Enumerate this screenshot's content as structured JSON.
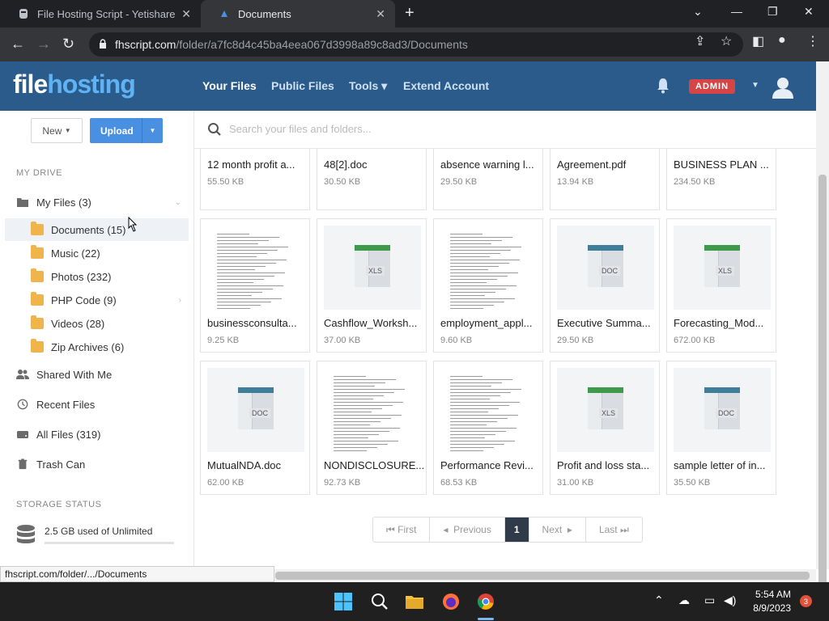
{
  "browser": {
    "tabs": [
      {
        "title": "File Hosting Script - Yetishare",
        "active": false
      },
      {
        "title": "Documents",
        "active": true
      }
    ],
    "url_host": "fhscript.com",
    "url_path": "/folder/a7fc8d4c45ba4eea067d3998a89c8ad3/Documents",
    "status_url": "fhscript.com/folder/.../Documents"
  },
  "header": {
    "logo_part1": "file",
    "logo_part2": "hosting",
    "nav": [
      {
        "label": "Your Files",
        "active": true
      },
      {
        "label": "Public Files",
        "active": false
      },
      {
        "label": "Tools ▾",
        "active": false
      },
      {
        "label": "Extend Account",
        "active": false
      }
    ],
    "admin_badge": "ADMIN"
  },
  "toolbar": {
    "new_label": "New",
    "upload_label": "Upload",
    "search_placeholder": "Search your files and folders..."
  },
  "sidebar": {
    "my_drive_heading": "MY DRIVE",
    "my_files": "My Files (3)",
    "folders": [
      {
        "label": "Documents (15)",
        "selected": true
      },
      {
        "label": "Music (22)"
      },
      {
        "label": "Photos (232)"
      },
      {
        "label": "PHP Code (9)"
      },
      {
        "label": "Videos (28)"
      },
      {
        "label": "Zip Archives (6)"
      }
    ],
    "links": [
      {
        "label": "Shared With Me"
      },
      {
        "label": "Recent Files"
      },
      {
        "label": "All Files (319)"
      },
      {
        "label": "Trash Can"
      }
    ],
    "storage_heading": "STORAGE STATUS",
    "storage_text": "2.5 GB used of Unlimited"
  },
  "files": [
    {
      "name": "12 month profit a...",
      "size": "55.50 KB",
      "kind": "paper"
    },
    {
      "name": "48[2].doc",
      "size": "30.50 KB",
      "kind": "doc"
    },
    {
      "name": "absence warning l...",
      "size": "29.50 KB",
      "kind": "doc"
    },
    {
      "name": "Agreement.pdf",
      "size": "13.94 KB",
      "kind": "paper"
    },
    {
      "name": "BUSINESS PLAN ...",
      "size": "234.50 KB",
      "kind": "doc"
    },
    {
      "name": "businessconsulta...",
      "size": "9.25 KB",
      "kind": "paper"
    },
    {
      "name": "Cashflow_Worksh...",
      "size": "37.00 KB",
      "kind": "xls"
    },
    {
      "name": "employment_appl...",
      "size": "9.60 KB",
      "kind": "paper"
    },
    {
      "name": "Executive Summa...",
      "size": "29.50 KB",
      "kind": "doc"
    },
    {
      "name": "Forecasting_Mod...",
      "size": "672.00 KB",
      "kind": "xls"
    },
    {
      "name": "MutualNDA.doc",
      "size": "62.00 KB",
      "kind": "doc"
    },
    {
      "name": "NONDISCLOSURE...",
      "size": "92.73 KB",
      "kind": "paper"
    },
    {
      "name": "Performance Revi...",
      "size": "68.53 KB",
      "kind": "paper"
    },
    {
      "name": "Profit and loss sta...",
      "size": "31.00 KB",
      "kind": "xls"
    },
    {
      "name": "sample letter of in...",
      "size": "35.50 KB",
      "kind": "doc"
    }
  ],
  "labels": {
    "doc": "DOC",
    "xls": "XLS"
  },
  "pagination": {
    "first": "First",
    "previous": "Previous",
    "current": "1",
    "next": "Next",
    "last": "Last"
  },
  "taskbar": {
    "time": "5:54 AM",
    "date": "8/9/2023",
    "notifications": "3"
  }
}
